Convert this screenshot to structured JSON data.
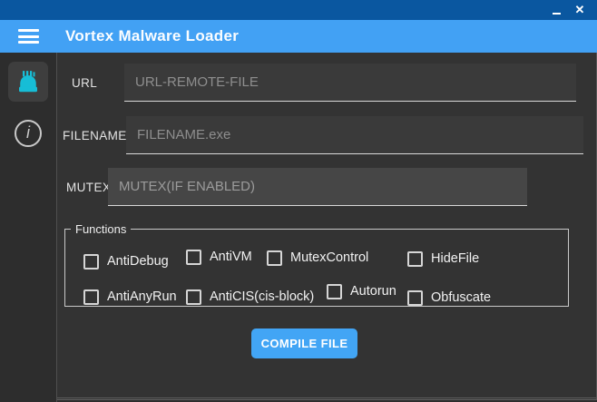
{
  "titlebar": {
    "close_glyph": "✕"
  },
  "header": {
    "title": "Vortex Malware Loader"
  },
  "sidebar": {
    "items": [
      {
        "name": "builder",
        "icon": "cake-icon",
        "active": true
      },
      {
        "name": "info",
        "icon": "info-icon",
        "glyph": "i",
        "active": false
      }
    ]
  },
  "form": {
    "fields": [
      {
        "label": "URL",
        "placeholder": "URL-REMOTE-FILE",
        "value": ""
      },
      {
        "label": "FILENAME",
        "placeholder": "FILENAME.exe",
        "value": ""
      },
      {
        "label": "MUTEX",
        "placeholder": "MUTEX(IF ENABLED)",
        "value": "",
        "disabled": true
      }
    ],
    "functions": {
      "legend": "Functions",
      "options": [
        {
          "label": "AntiDebug",
          "checked": false
        },
        {
          "label": "AntiVM",
          "checked": false
        },
        {
          "label": "MutexControl",
          "checked": false
        },
        {
          "label": "HideFile",
          "checked": false
        },
        {
          "label": "AntiAnyRun",
          "checked": false
        },
        {
          "label": "AntiCIS(cis-block)",
          "checked": false
        },
        {
          "label": "Autorun",
          "checked": false
        },
        {
          "label": "Obfuscate",
          "checked": false
        }
      ]
    },
    "compile_button_label": "COMPILE FILE"
  },
  "colors": {
    "titlebar_bg": "#0a57a0",
    "header_bg": "#42a1f4",
    "sidebar_bg": "#2d2d2d",
    "main_bg": "#333333",
    "accent_blue": "#42a5f5",
    "icon_cyan": "#17bdd6"
  }
}
